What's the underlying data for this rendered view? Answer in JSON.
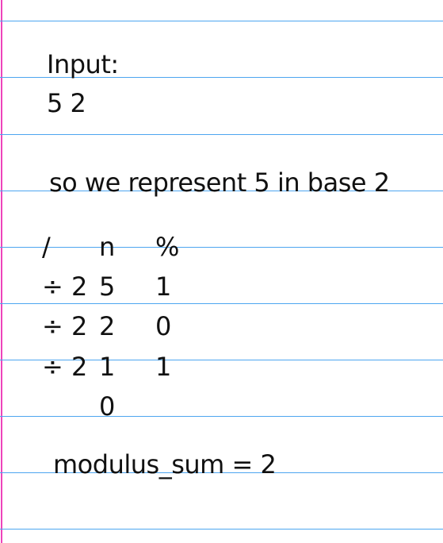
{
  "colors": {
    "ruled_line": "#4da6f0",
    "margin_line": "#ee44bb",
    "ink": "#111111",
    "paper": "#ffffff"
  },
  "note": {
    "input_label": "Input:",
    "input_value": "5 2",
    "explanation": "so we represent 5 in base 2",
    "table": {
      "headers": [
        "/",
        "n",
        "%"
      ],
      "rows": [
        [
          "÷ 2",
          "5",
          "1"
        ],
        [
          "÷ 2",
          "2",
          "0"
        ],
        [
          "÷ 2",
          "1",
          "1"
        ],
        [
          "",
          "0",
          ""
        ]
      ]
    },
    "result": "modulus_sum = 2"
  }
}
